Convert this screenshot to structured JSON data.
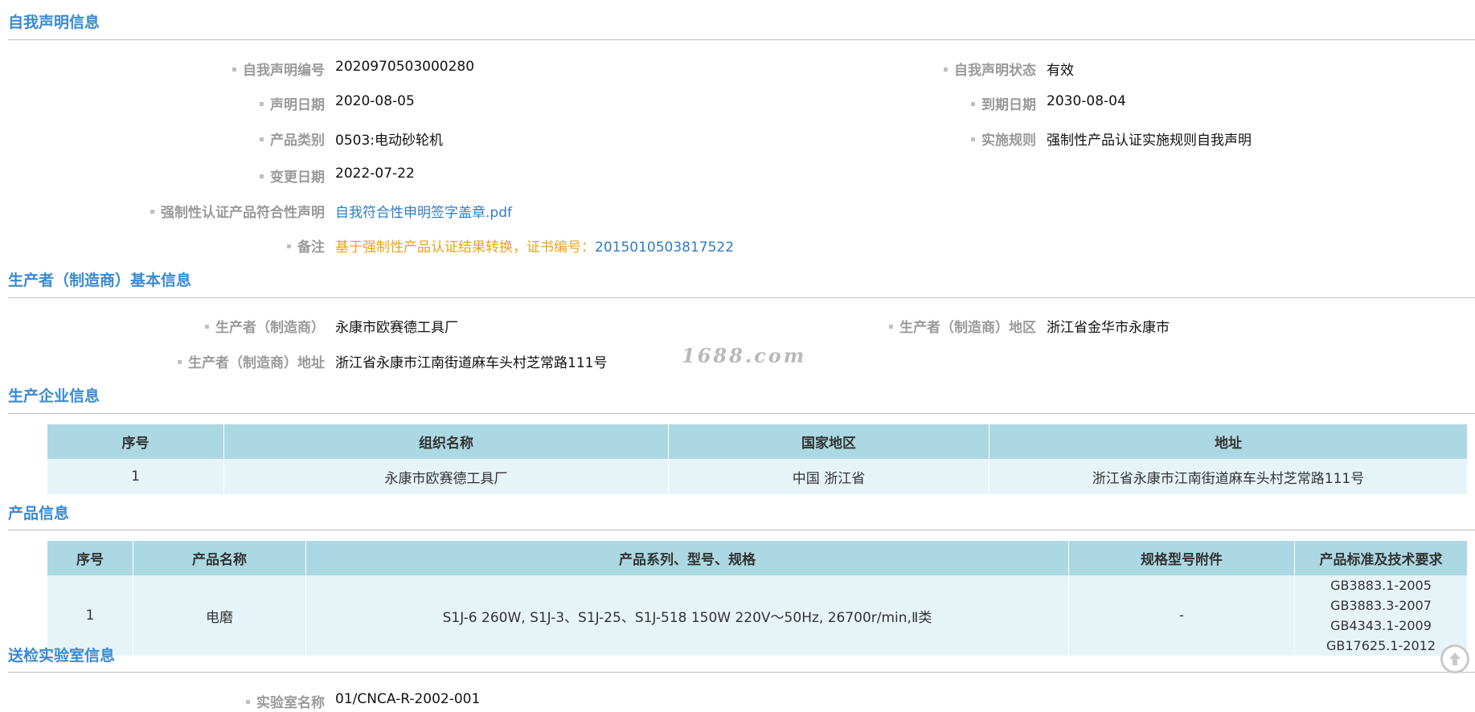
{
  "sections": {
    "declaration": "自我声明信息",
    "manufacturer": "生产者（制造商）基本信息",
    "enterprise": "生产企业信息",
    "product": "产品信息",
    "lab": "送检实验室信息"
  },
  "declaration": {
    "number_label": "自我声明编号",
    "number": "2020970503000280",
    "status_label": "自我声明状态",
    "status": "有效",
    "date_label": "声明日期",
    "date": "2020-08-05",
    "expiry_label": "到期日期",
    "expiry": "2030-08-04",
    "category_label": "产品类别",
    "category": "0503:电动砂轮机",
    "rule_label": "实施规则",
    "rule": "强制性产品认证实施规则自我声明",
    "change_label": "变更日期",
    "change": "2022-07-22",
    "conformity_label": "强制性认证产品符合性声明",
    "conformity_file": "自我符合性申明签字盖章.pdf",
    "remark_label": "备注",
    "remark_text": "基于强制性产品认证结果转换，证书编号：",
    "remark_cert": "2015010503817522"
  },
  "manufacturer": {
    "name_label": "生产者（制造商）",
    "name": "永康市欧赛德工具厂",
    "region_label": "生产者（制造商）地区",
    "region": "浙江省金华市永康市",
    "address_label": "生产者（制造商）地址",
    "address": "浙江省永康市江南街道麻车头村芝常路111号"
  },
  "watermark": "1688.com",
  "enterprise_table": {
    "headers": [
      "序号",
      "组织名称",
      "国家地区",
      "地址"
    ],
    "rows": [
      [
        "1",
        "永康市欧赛德工具厂",
        "中国 浙江省",
        "浙江省永康市江南街道麻车头村芝常路111号"
      ]
    ]
  },
  "product_table": {
    "headers": [
      "序号",
      "产品名称",
      "产品系列、型号、规格",
      "规格型号附件",
      "产品标准及技术要求"
    ],
    "rows": [
      [
        "1",
        "电磨",
        "S1J-6 260W, S1J-3、S1J-25、S1J-518 150W 220V～50Hz, 26700r/min,Ⅱ类",
        "-",
        "GB3883.1-2005 GB3883.3-2007 GB4343.1-2009 GB17625.1-2012"
      ]
    ]
  },
  "lab": {
    "name_label": "实验室名称",
    "name": "01/CNCA-R-2002-001"
  },
  "icons": {
    "scroll_top": "arrow-up-circle-icon"
  },
  "colors": {
    "section_title": "#3a8ad0",
    "table_header": "#acd8e3",
    "table_row": "#e6f4f8",
    "remark": "#e8a317",
    "link": "#2f7dc3"
  }
}
